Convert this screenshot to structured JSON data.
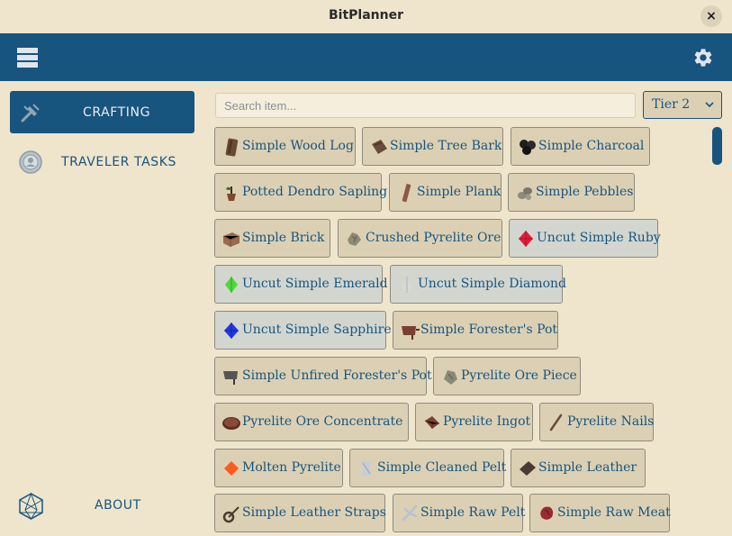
{
  "window": {
    "title": "BitPlanner",
    "close_label": "×"
  },
  "appbar": {
    "menu_icon": "menu-icon",
    "settings_icon": "gear-icon"
  },
  "sidebar": {
    "items": [
      {
        "label": "CRAFTING",
        "icon": "crafting-icon",
        "active": true
      },
      {
        "label": "TRAVELER TASKS",
        "icon": "traveler-icon",
        "active": false
      }
    ],
    "about": {
      "label": "ABOUT",
      "icon": "about-icon"
    }
  },
  "search": {
    "placeholder": "Search item..."
  },
  "tier": {
    "value": "Tier 2"
  },
  "items": [
    {
      "label": "Simple Wood Log",
      "icon": "wood-log",
      "color": "#6b4a34"
    },
    {
      "label": "Simple Tree Bark",
      "icon": "tree-bark",
      "color": "#6a4a3c"
    },
    {
      "label": "Simple Charcoal",
      "icon": "charcoal",
      "color": "#1e1e1e"
    },
    {
      "label": "Potted Dendro Sapling",
      "icon": "sapling",
      "color": "#7a4a30"
    },
    {
      "label": "Simple Plank",
      "icon": "plank",
      "color": "#8a5a44"
    },
    {
      "label": "Simple Pebbles",
      "icon": "pebbles",
      "color": "#8c8a7a"
    },
    {
      "label": "Simple Brick",
      "icon": "brick",
      "color": "#9a6a4e"
    },
    {
      "label": "Crushed Pyrelite Ore",
      "icon": "crushed-ore",
      "color": "#8e8a78"
    },
    {
      "label": "Uncut Simple Ruby",
      "icon": "ruby",
      "color": "#e01e3a"
    },
    {
      "label": "Uncut Simple Emerald",
      "icon": "emerald",
      "color": "#4cd93a"
    },
    {
      "label": "Uncut Simple Diamond",
      "icon": "diamond",
      "color": "#cfcfcf"
    },
    {
      "label": "Uncut Simple Sapphire",
      "icon": "sapphire",
      "color": "#2438e0"
    },
    {
      "label": "Simple Forester's Pot",
      "icon": "forester-pot",
      "color": "#7a4030"
    },
    {
      "label": "Simple Unfired Forester's Pot",
      "icon": "unfired-pot",
      "color": "#555555"
    },
    {
      "label": "Pyrelite Ore Piece",
      "icon": "ore-piece",
      "color": "#8a8a78"
    },
    {
      "label": "Pyrelite Ore Concentrate",
      "icon": "ore-concentrate",
      "color": "#8a4a38"
    },
    {
      "label": "Pyrelite Ingot",
      "icon": "ingot",
      "color": "#7a4030"
    },
    {
      "label": "Pyrelite Nails",
      "icon": "nails",
      "color": "#6a4a3a"
    },
    {
      "label": "Molten Pyrelite",
      "icon": "molten",
      "color": "#ff5a1e"
    },
    {
      "label": "Simple Cleaned Pelt",
      "icon": "cleaned-pelt",
      "color": "#c8ccd8"
    },
    {
      "label": "Simple Leather",
      "icon": "leather",
      "color": "#4a3a34"
    },
    {
      "label": "Simple Leather Straps",
      "icon": "leather-straps",
      "color": "#4a3a30"
    },
    {
      "label": "Simple Raw Pelt",
      "icon": "raw-pelt",
      "color": "#c0c8d8"
    },
    {
      "label": "Simple Raw Meat",
      "icon": "raw-meat",
      "color": "#9a2a34"
    }
  ],
  "colors": {
    "accent": "#17547e",
    "background": "#efe5cc",
    "item_bg": "#dcd0b4"
  }
}
